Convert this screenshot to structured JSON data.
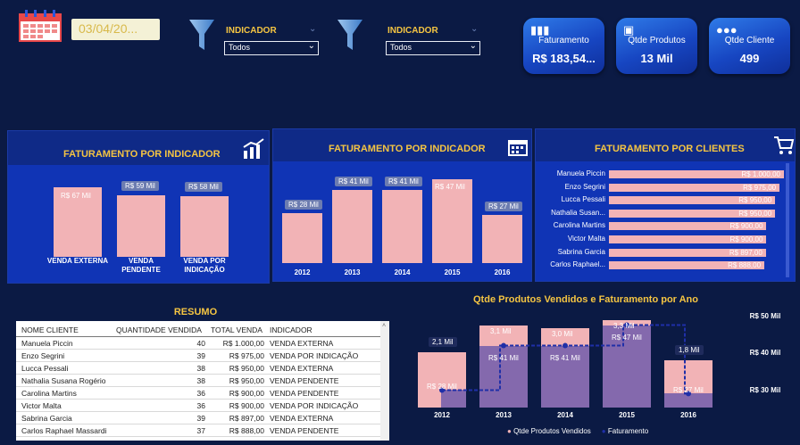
{
  "filters": {
    "date_value": "03/04/20...",
    "indicador1": {
      "label": "INDICADOR",
      "selected": "Todos"
    },
    "indicador2": {
      "label": "INDICADOR",
      "selected": "Todos"
    }
  },
  "kpis": [
    {
      "title": "Faturamento",
      "value": "R$ 183,54...",
      "icon": "bar-chart-icon"
    },
    {
      "title": "Qtde Produtos",
      "value": "13 Mil",
      "icon": "box-icon"
    },
    {
      "title": "Qtde Cliente",
      "value": "499",
      "icon": "users-icon"
    }
  ],
  "panel1": {
    "title": "FATURAMENTO POR INDICADOR",
    "chart_data": {
      "type": "bar",
      "categories": [
        "VENDA EXTERNA",
        "VENDA PENDENTE",
        "VENDA POR INDICAÇÃO"
      ],
      "cat_lines": [
        [
          "VENDA EXTERNA"
        ],
        [
          "VENDA",
          "PENDENTE"
        ],
        [
          "VENDA POR",
          "INDICAÇÃO"
        ]
      ],
      "values": [
        67,
        59,
        58
      ],
      "labels": [
        "R$ 67 Mil",
        "R$ 59 Mil",
        "R$ 58 Mil"
      ]
    }
  },
  "panel2": {
    "title": "FATURAMENTO POR INDICADOR",
    "chart_data": {
      "type": "bar",
      "categories": [
        "2012",
        "2013",
        "2014",
        "2015",
        "2016"
      ],
      "values": [
        28,
        41,
        41,
        47,
        27
      ],
      "labels": [
        "R$ 28 Mil",
        "R$ 41 Mil",
        "R$ 41 Mil",
        "R$ 47 Mil",
        "R$ 27 Mil"
      ]
    }
  },
  "panel3": {
    "title": "FATURAMENTO POR CLIENTES",
    "chart_data": {
      "type": "bar",
      "categories": [
        "Manuela Piccin",
        "Enzo Segrini",
        "Lucca Pessali",
        "Nathalia Susan...",
        "Carolina Martins",
        "Victor Malta",
        "Sabrina Garcia",
        "Carlos Raphael..."
      ],
      "values": [
        1000,
        975,
        950,
        950,
        900,
        900,
        897,
        888
      ],
      "labels": [
        "R$ 1.000,00",
        "R$ 975,00",
        "R$ 950,00",
        "R$ 950,00",
        "R$ 900,00",
        "R$ 900,00",
        "R$ 897,00",
        "R$ 888,00"
      ]
    }
  },
  "table": {
    "title": "RESUMO",
    "columns": [
      "NOME CLIENTE",
      "QUANTIDADE VENDIDA",
      "TOTAL VENDA",
      "INDICADOR"
    ],
    "rows": [
      [
        "Manuela Piccin",
        "40",
        "R$ 1.000,00",
        "VENDA EXTERNA"
      ],
      [
        "Enzo Segrini",
        "39",
        "R$ 975,00",
        "VENDA POR INDICAÇÃO"
      ],
      [
        "Lucca Pessali",
        "38",
        "R$ 950,00",
        "VENDA EXTERNA"
      ],
      [
        "Nathalia Susana Rogério",
        "38",
        "R$ 950,00",
        "VENDA PENDENTE"
      ],
      [
        "Carolina Martins",
        "36",
        "R$ 900,00",
        "VENDA PENDENTE"
      ],
      [
        "Victor Malta",
        "36",
        "R$ 900,00",
        "VENDA POR INDICAÇÃO"
      ],
      [
        "Sabrina Garcia",
        "39",
        "R$ 897,00",
        "VENDA EXTERNA"
      ],
      [
        "Carlos Raphael Massardi",
        "37",
        "R$ 888,00",
        "VENDA PENDENTE"
      ]
    ]
  },
  "combo": {
    "title": "Qtde Produtos Vendidos e Faturamento por Ano",
    "chart_data": {
      "type": "bar",
      "categories": [
        "2012",
        "2013",
        "2014",
        "2015",
        "2016"
      ],
      "series": [
        {
          "name": "Qtde Produtos Vendidos",
          "values": [
            2.1,
            3.1,
            3.0,
            3.3,
            1.8
          ],
          "labels": [
            "2,1 Mil",
            "3,1 Mil",
            "3,0 Mil",
            "3,3 Mil",
            "1,8 Mil"
          ]
        },
        {
          "name": "Faturamento",
          "values": [
            28,
            41,
            41,
            47,
            27
          ],
          "labels": [
            "R$ 28 Mil",
            "R$ 41 Mil",
            "R$ 41 Mil",
            "R$ 47 Mil",
            "R$ 27 Mil"
          ]
        }
      ],
      "right_axis_ticks": [
        "R$ 50 Mil",
        "R$ 40 Mil",
        "R$ 30 Mil"
      ],
      "colors": {
        "bars": "#f2b3b6",
        "line": "#1f2fa8"
      }
    }
  }
}
